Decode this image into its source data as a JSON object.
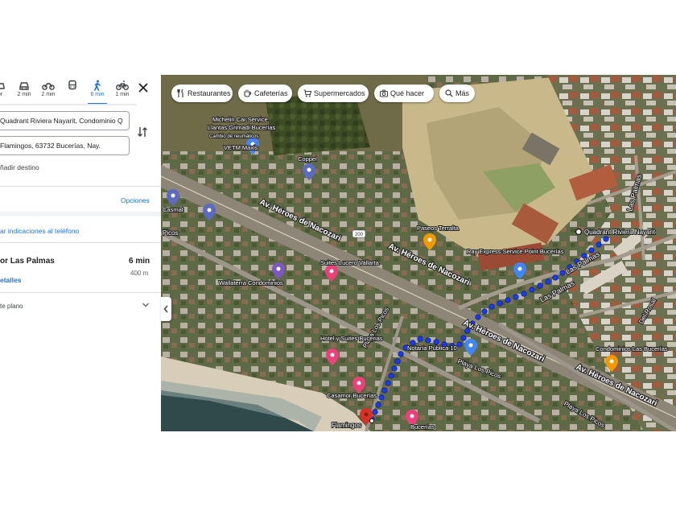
{
  "directions": {
    "modes": [
      {
        "icon": "car-icon-partial",
        "time": "or"
      },
      {
        "icon": "car-icon",
        "time": "2 min"
      },
      {
        "icon": "motorcycle-icon",
        "time": "2 min"
      },
      {
        "icon": "transit-icon",
        "time": ""
      },
      {
        "icon": "walk-icon",
        "time": "6 min",
        "active": true
      },
      {
        "icon": "bike-icon",
        "time": "1 min"
      }
    ],
    "origin": "Quadrant Riviera Nayarit, Condominio Q",
    "destination": "Flamingos, 63732 Bucerías, Nay.",
    "add_destination": "ñadir destino",
    "options_label": "Opciones",
    "send_to_phone": "ar indicaciones al teléfono",
    "route_name": "or Las Palmas",
    "duration": "6 min",
    "distance": "400 m",
    "details_label": "etalles",
    "terrain_label": "te plano"
  },
  "map": {
    "chips": [
      {
        "icon": "restaurant-icon",
        "label": "Restaurantes"
      },
      {
        "icon": "coffee-icon",
        "label": "Cafeterías"
      },
      {
        "icon": "cart-icon",
        "label": "Supermercados"
      },
      {
        "icon": "camera-icon",
        "label": "Qué hacer"
      },
      {
        "icon": "search-icon",
        "label": "Más"
      }
    ],
    "streets": {
      "avenue": "Av. Héroes de Nacozari",
      "las_palmas": "Las Palmas",
      "playa_los_picos": "Playa Los Picos",
      "del_rosal": "Del Rosal",
      "picos": "Picos",
      "highway": "200"
    },
    "places": {
      "origin": "Quadrant Riviera Nayarit",
      "destination": "Flamingos",
      "michelin": "Michelin Car Service",
      "llantas": "Llantas Grimadi Bucerías",
      "michelin_sub": "Cambio de neumáticos",
      "vetmax": "VETM Maxis",
      "coppel": "Coppel",
      "casmat": "Casmat",
      "suites": "Suites Lucero Vallarta",
      "wallaterra": "Wallaterra Condominios",
      "terralta": "Paseos Terralta",
      "express": "Ray Express Service Point Bucerías",
      "notaria": "Notaría Pública 10",
      "hotel": "Hotel y Suites Bucerias",
      "casamor": "Casamor Bucerías",
      "condos": "Condominios Las Bucerías",
      "bucerias": "Bucerías"
    }
  }
}
